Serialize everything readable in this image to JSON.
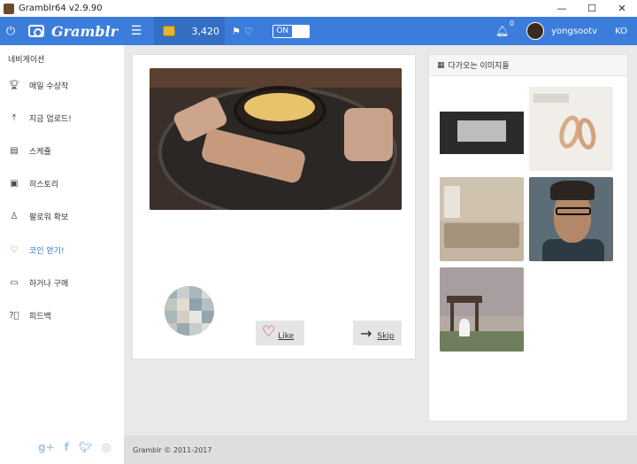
{
  "window": {
    "title": "Gramblr64 v2.9.90",
    "minimize": "—",
    "maximize": "☐",
    "close": "✕"
  },
  "topbar": {
    "power_icon": "power-icon",
    "logo_text": "Gramblr",
    "menu_icon": "hamburger-icon",
    "coin_count": "3,420",
    "toggle_label": "ON",
    "notification_count": "0",
    "username": "yongsootv",
    "language": "KO"
  },
  "sidebar": {
    "title": "네비게이션",
    "items": [
      {
        "label": "매일 수상작",
        "icon": "trophy-icon"
      },
      {
        "label": "지금 업로드!",
        "icon": "upload-icon"
      },
      {
        "label": "스케쥴",
        "icon": "calendar-icon"
      },
      {
        "label": "히스토리",
        "icon": "book-icon"
      },
      {
        "label": "팔로워 확보",
        "icon": "user-icon"
      },
      {
        "label": "코인 얻기!",
        "icon": "heart-icon"
      },
      {
        "label": "하거나 구매",
        "icon": "wallet-icon"
      },
      {
        "label": "피드백",
        "icon": "question-icon"
      }
    ],
    "active_index": 5,
    "social_icons": [
      "google-plus-icon",
      "facebook-icon",
      "twitter-icon",
      "instagram-icon"
    ]
  },
  "main": {
    "like_label": "Like",
    "skip_label": "Skip"
  },
  "upcoming": {
    "title": "다가오는 이미지들"
  },
  "footer": {
    "copyright": "Gramblr © 2011-2017"
  }
}
